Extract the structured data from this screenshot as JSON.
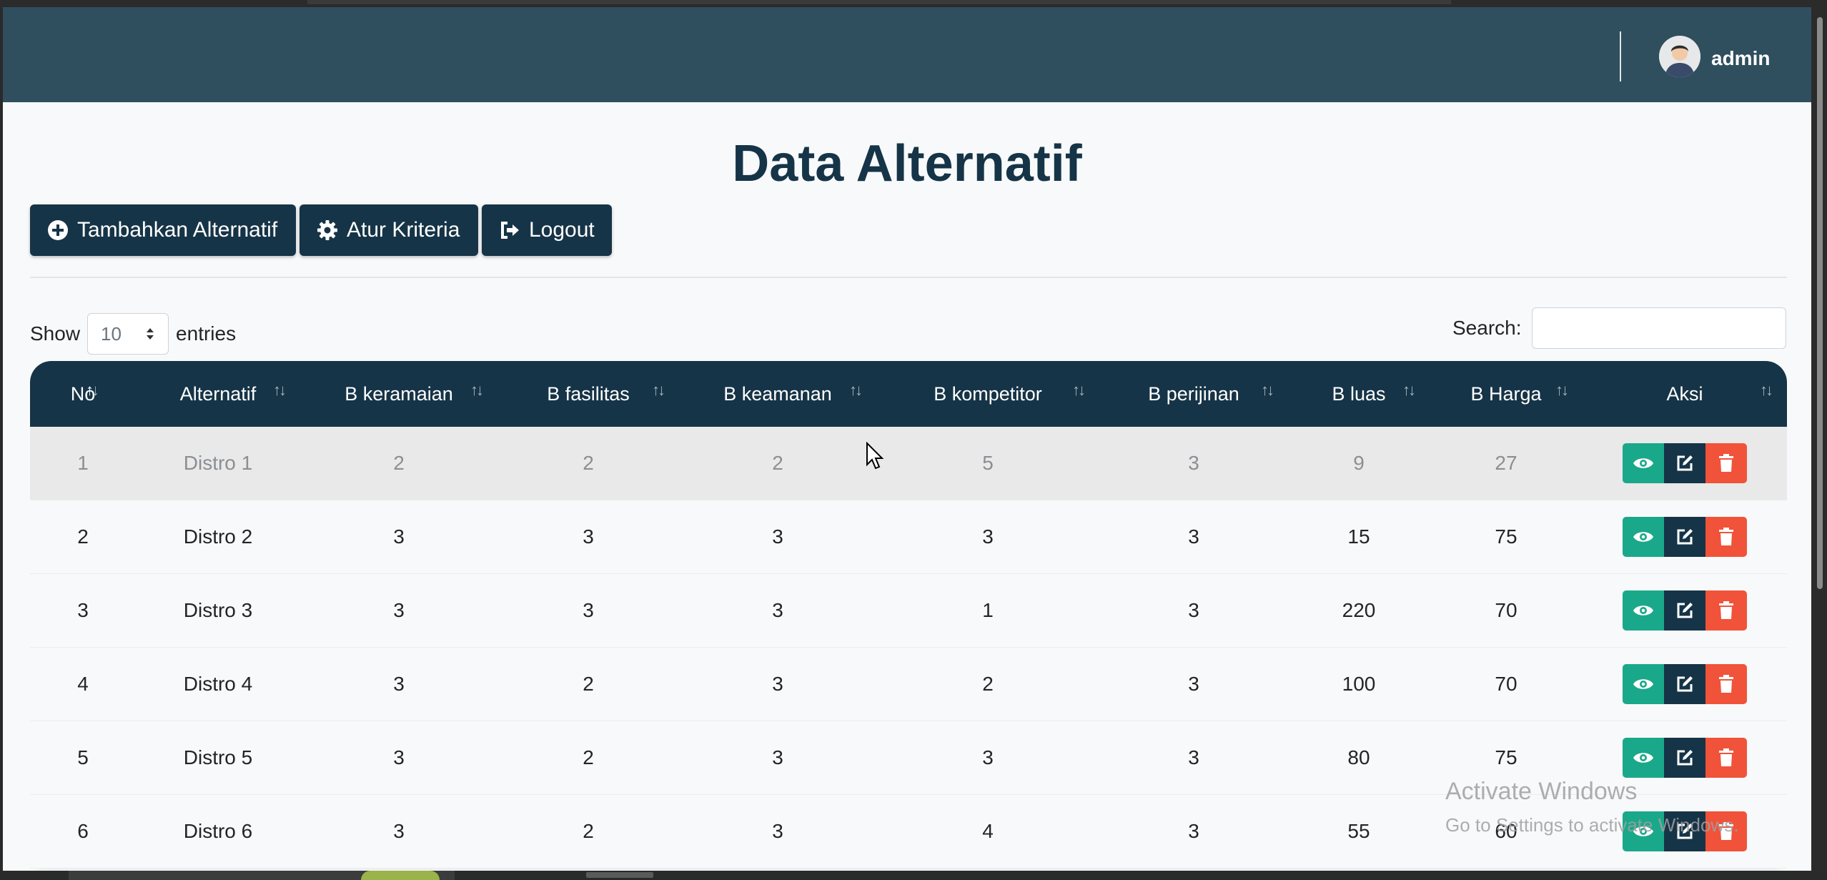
{
  "navbar": {
    "username": "admin"
  },
  "page": {
    "title": "Data Alternatif"
  },
  "toolbar": {
    "add_label": "Tambahkan Alternatif",
    "kriteria_label": "Atur Kriteria",
    "logout_label": "Logout"
  },
  "length": {
    "show_label": "Show",
    "value": "10",
    "entries_label": "entries"
  },
  "search": {
    "label": "Search:",
    "value": ""
  },
  "table": {
    "headers": [
      "No",
      "Alternatif",
      "B keramaian",
      "B fasilitas",
      "B keamanan",
      "B kompetitor",
      "B perijinan",
      "B luas",
      "B Harga",
      "Aksi"
    ],
    "rows": [
      [
        "1",
        "Distro 1",
        "2",
        "2",
        "2",
        "5",
        "3",
        "9",
        "27"
      ],
      [
        "2",
        "Distro 2",
        "3",
        "3",
        "3",
        "3",
        "3",
        "15",
        "75"
      ],
      [
        "3",
        "Distro 3",
        "3",
        "3",
        "3",
        "1",
        "3",
        "220",
        "70"
      ],
      [
        "4",
        "Distro 4",
        "3",
        "2",
        "3",
        "2",
        "3",
        "100",
        "70"
      ],
      [
        "5",
        "Distro 5",
        "3",
        "2",
        "3",
        "3",
        "3",
        "80",
        "75"
      ],
      [
        "6",
        "Distro 6",
        "3",
        "2",
        "3",
        "4",
        "3",
        "55",
        "60"
      ]
    ]
  },
  "watermark": {
    "line1": "Activate Windows",
    "line2": "Go to Settings to activate Windows."
  },
  "colors": {
    "navbar": "#2f4f5e",
    "primary": "#163447",
    "view": "#1aa88a",
    "delete": "#f0533a"
  }
}
